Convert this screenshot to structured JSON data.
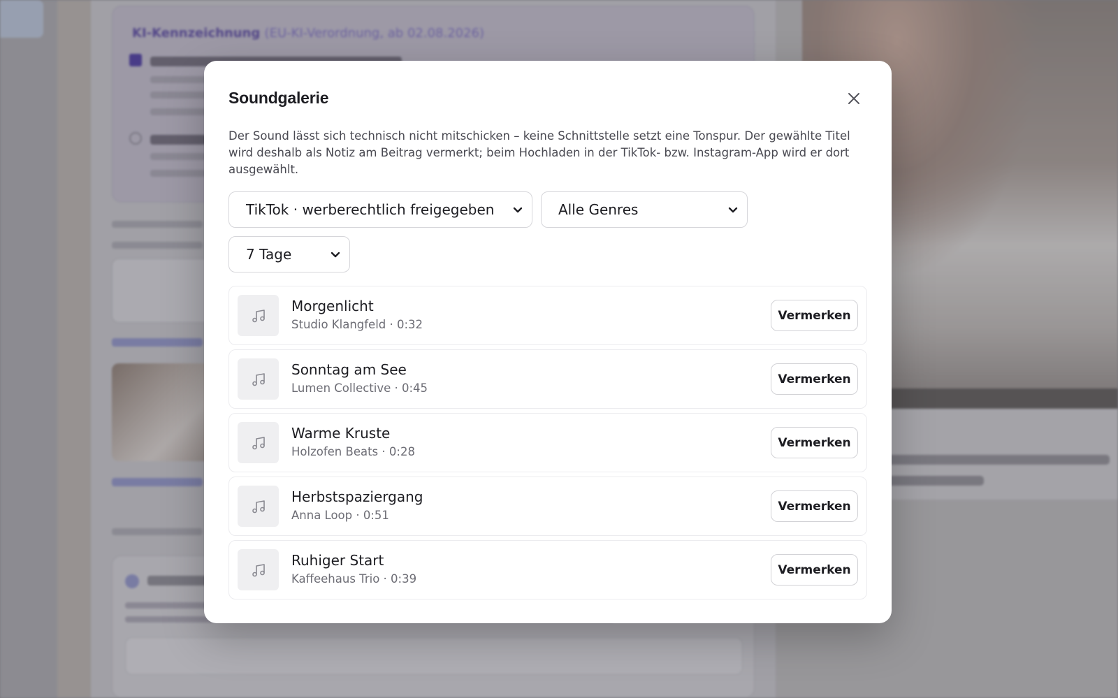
{
  "modal": {
    "title": "Soundgalerie",
    "description": "Der Sound lässt sich technisch nicht mitschicken – keine Schnittstelle setzt eine Tonspur. Der gewählte Titel wird deshalb als Notiz am Beitrag vermerkt; beim Hochladen in der TikTok- bzw. Instagram-App wird er dort ausgewählt.",
    "close_icon": "close-icon"
  },
  "filters": {
    "platform": "TikTok · werberechtlich freigegeben",
    "genre": "Alle Genres",
    "period": "7 Tage"
  },
  "tracks": [
    {
      "title": "Morgenlicht",
      "meta": "Studio Klangfeld · 0:32",
      "action": "Vermerken"
    },
    {
      "title": "Sonntag am See",
      "meta": "Lumen Collective · 0:45",
      "action": "Vermerken"
    },
    {
      "title": "Warme Kruste",
      "meta": "Holzofen Beats · 0:28",
      "action": "Vermerken"
    },
    {
      "title": "Herbstspaziergang",
      "meta": "Anna Loop · 0:51",
      "action": "Vermerken"
    },
    {
      "title": "Ruhiger Start",
      "meta": "Kaffeehaus Trio · 0:39",
      "action": "Vermerken"
    }
  ],
  "background": {
    "ki_title": "KI-Kennzeichnung",
    "ki_subtitle": "(EU-KI-Verordnung, ab 02.08.2026)"
  },
  "colors": {
    "accent": "#4b3a9e",
    "text": "#1d1d22",
    "muted": "#6d6d75"
  }
}
